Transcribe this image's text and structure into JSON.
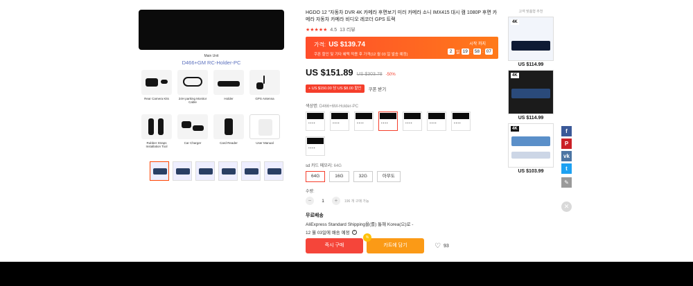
{
  "gallery": {
    "main_unit": "Main Unit",
    "variant_title": "D466+GM RC-Holder-PC",
    "accessories": [
      {
        "label": "Rear Camera Kits"
      },
      {
        "label": "24H parking Monitor Cable"
      },
      {
        "label": "Holder"
      },
      {
        "label": "GPS Antenna"
      },
      {
        "label": "Rubber Straps Installation Tool"
      },
      {
        "label": "Car Charger"
      },
      {
        "label": "Card Reader"
      },
      {
        "label": "User Manual"
      }
    ],
    "thumb_count": 6
  },
  "product": {
    "title": "HGDO 12 \"자동차 DVR 4K 카메라 후면보기 미러 카메라 소니 IMX415 대시 캠 1080P 후면 카메라 자동차 카메라 비디오 레코더 GPS 트랙",
    "rating": "4.5",
    "reviews": "13 리뷰",
    "promo": {
      "price_label": "가격:",
      "price": "US $139.74",
      "note": "쿠폰 할인 및 기타 혜택 적용 후 가격(12 월 03 일 발송 예정)",
      "timer_title": "시작 까지",
      "days": "2",
      "days_unit": "일",
      "hours": "19",
      "minutes": "58",
      "seconds": "07"
    },
    "price": "US $151.89",
    "old_price": "US $303.78",
    "discount": "-50%",
    "coupon": "+ US $150.00 당 US $8.00 할인",
    "coupon_more": "쿠폰 받기",
    "color_label": "색상명:",
    "color_value": "D466+6M-Holder-PC",
    "sd_label": "sd 카드 메모리:",
    "sd_value": "64G",
    "sd_options": [
      "64G",
      "16G",
      "32G",
      "아무도"
    ],
    "qty_label": "수량:",
    "qty": "1",
    "qty_minus": "−",
    "qty_plus": "+",
    "availability": "196 개 구매 가능",
    "ship_title": "무료배송",
    "ship_line": "AliExpress Standard Shipping을(를) 통해 Korea(으)로 -",
    "ship_date": "12 월 03일에 배송 예정",
    "buy_now": "즉시 구매",
    "add_to_cart": "카트에 담기",
    "wishlist_count": "93"
  },
  "rail": {
    "title": "고객 맞춤형 추천",
    "items": [
      {
        "price": "US $114.99",
        "tag": "4K"
      },
      {
        "price": "US $114.99",
        "tag": "4K"
      },
      {
        "price": "US $103.99",
        "tag": "4K"
      }
    ]
  },
  "social": {
    "facebook": "f",
    "pinterest": "P",
    "vk": "vk",
    "twitter": "t",
    "edit": "✎",
    "close": "✕"
  }
}
